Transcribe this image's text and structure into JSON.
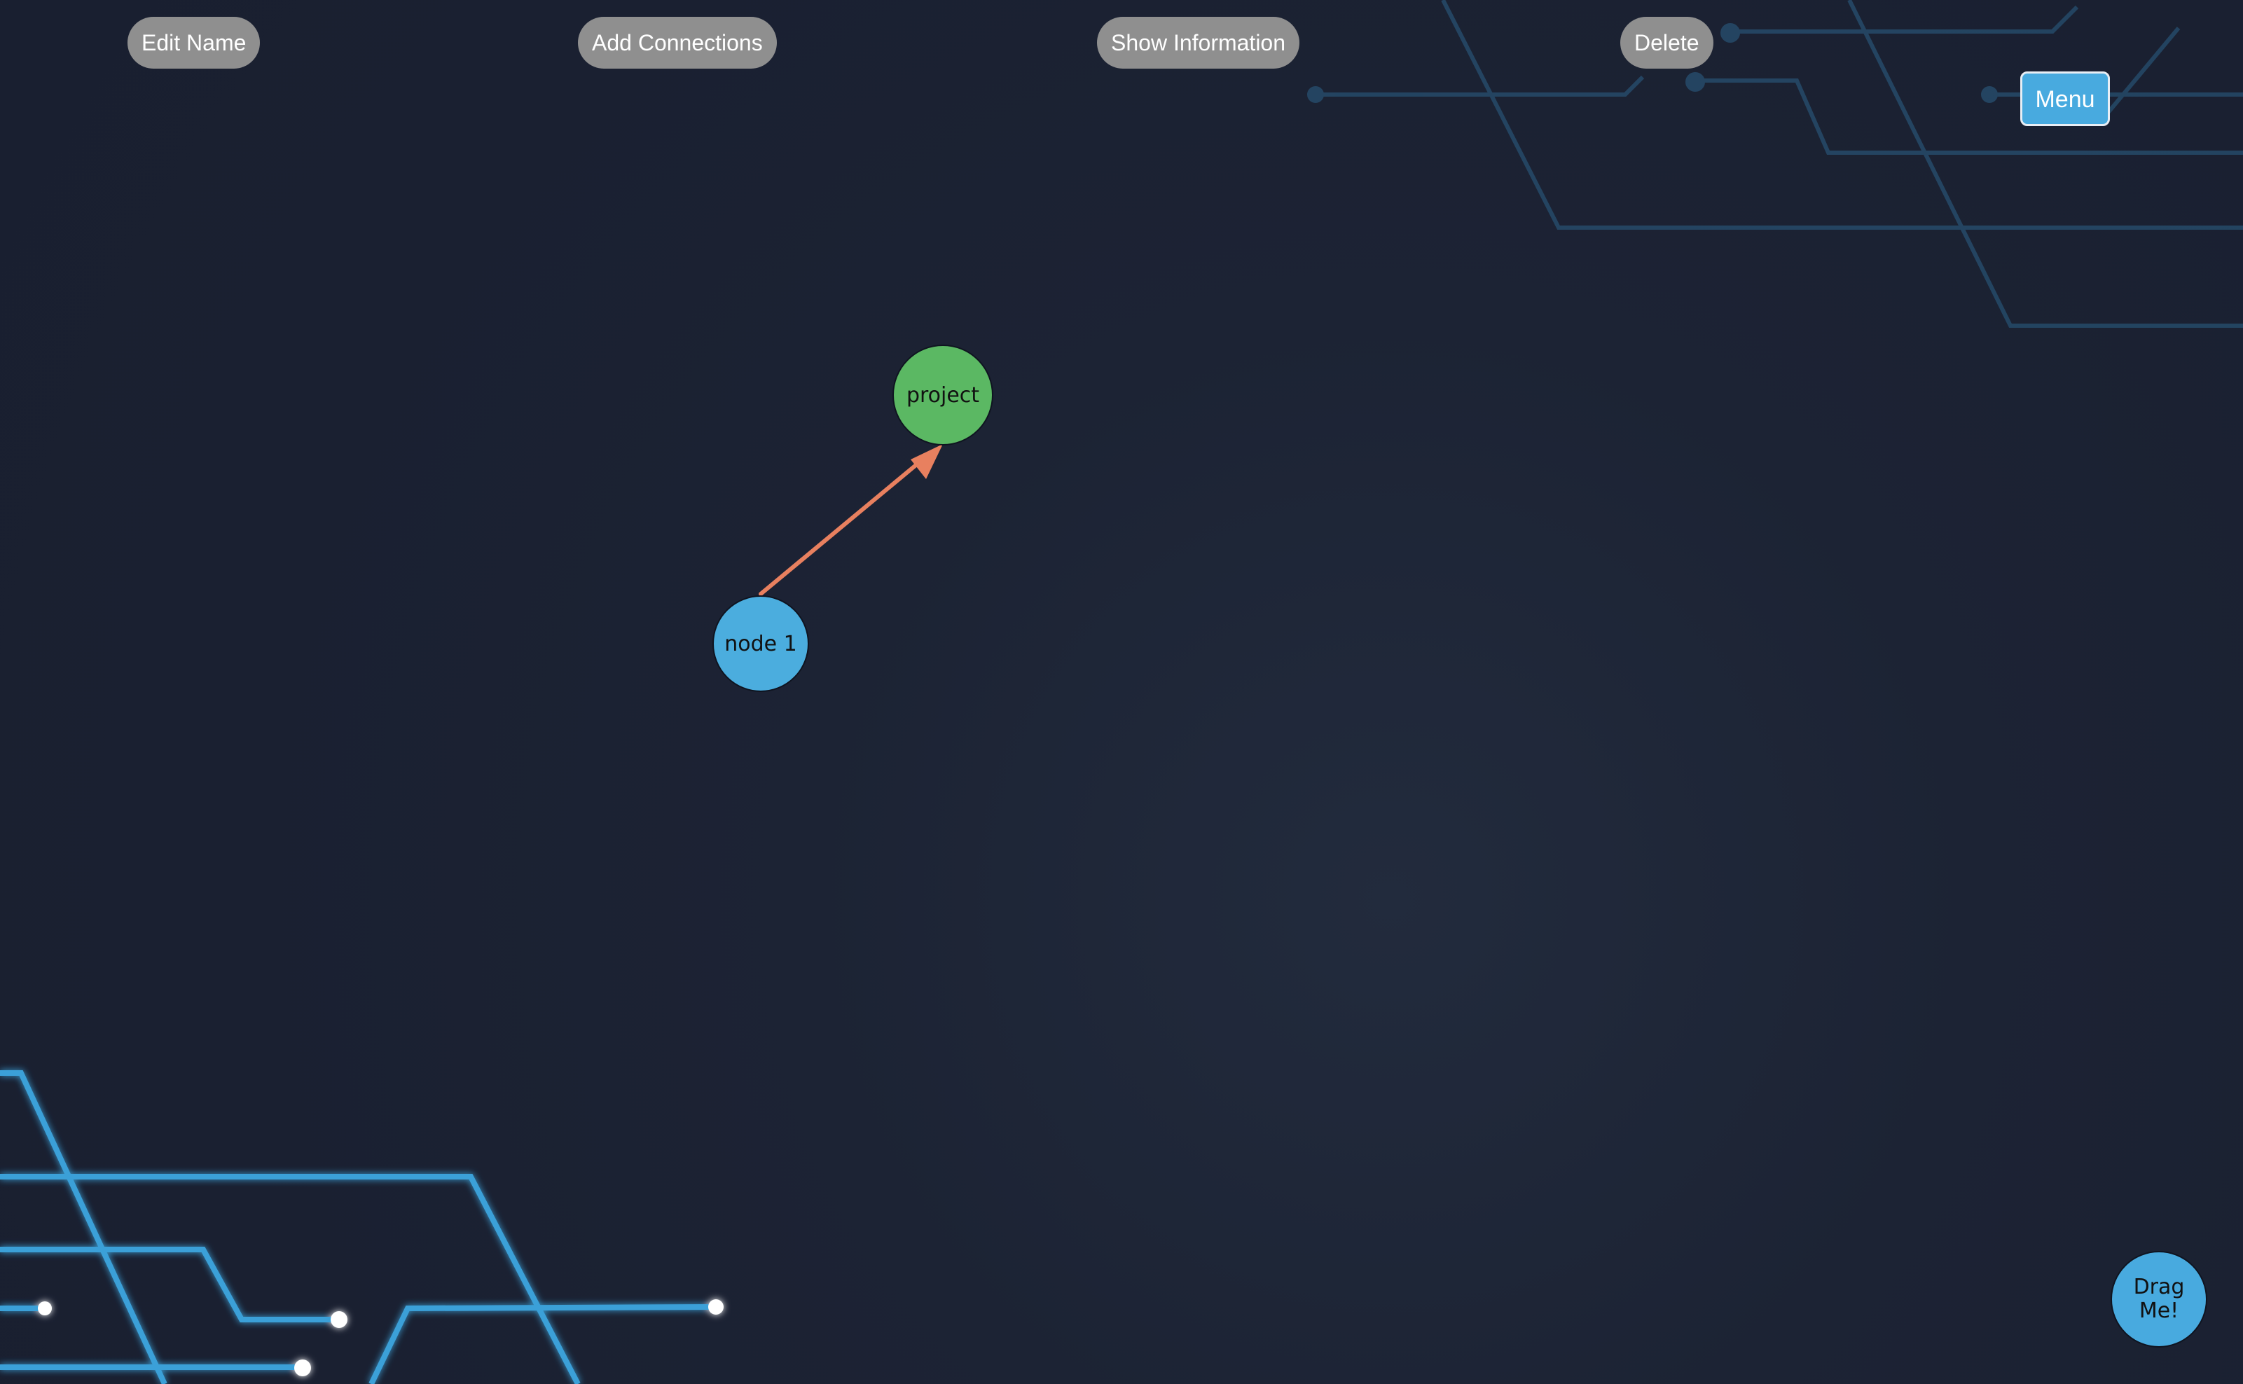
{
  "toolbar": {
    "edit_name": "Edit Name",
    "add_connections": "Add Connections",
    "show_information": "Show Information",
    "delete": "Delete"
  },
  "menu": {
    "label": "Menu"
  },
  "graph": {
    "nodes": [
      {
        "id": "project",
        "label": "project",
        "color": "#5bb863"
      },
      {
        "id": "node1",
        "label": "node 1",
        "color": "#4badde"
      }
    ],
    "edges": [
      {
        "from": "node1",
        "to": "project",
        "color": "#e8805f",
        "directed": true
      }
    ]
  },
  "drag_handle": {
    "label": "Drag Me!"
  },
  "colors": {
    "background": "#1c2334",
    "circuit_lines": "#3aa0d8",
    "toolbar_button": "#8f8f8f",
    "menu_button": "#48aadf"
  }
}
